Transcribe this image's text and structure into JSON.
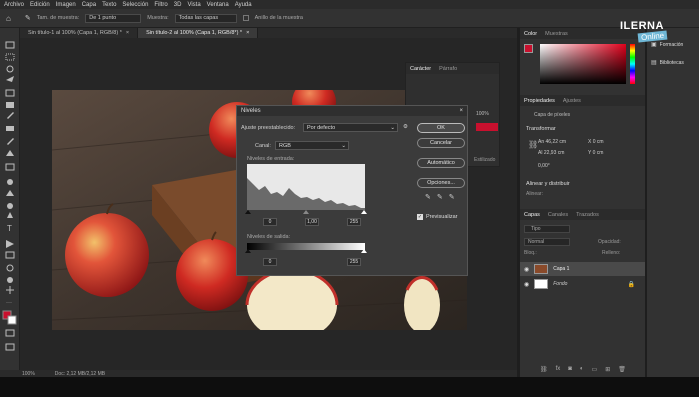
{
  "menubar": [
    "Archivo",
    "Edición",
    "Imagen",
    "Capa",
    "Texto",
    "Selección",
    "Filtro",
    "3D",
    "Vista",
    "Ventana",
    "Ayuda"
  ],
  "options": {
    "sample_size_label": "Tam. de muestra:",
    "sample_size_value": "De 1 punto",
    "sample_label": "Muestra:",
    "sample_value": "Todas las capas",
    "show_ring": "Anillo de la muestra"
  },
  "tabs": [
    {
      "label": "Sin título-1 al 100% (Capa 1, RGB/8) *",
      "active": false
    },
    {
      "label": "Sin título-2 al 100% (Capa 1, RGB/8*) *",
      "active": true
    }
  ],
  "status": {
    "zoom": "100%",
    "doc": "Doc: 2,12 MB/2,12 MB"
  },
  "dialog": {
    "title": "Niveles",
    "preset_label": "Ajuste preestablecido:",
    "preset_value": "Por defecto",
    "channel_label": "Canal:",
    "channel_value": "RGB",
    "input_label": "Niveles de entrada:",
    "input_values": [
      "0",
      "1,00",
      "255"
    ],
    "output_label": "Niveles de salida:",
    "output_values": [
      "0",
      "255"
    ],
    "ok": "OK",
    "cancel": "Cancelar",
    "auto": "Automático",
    "options": "Opciones...",
    "preview": "Previsualizar"
  },
  "char_panel": {
    "tabs": [
      "Carácter",
      "Párrafo"
    ],
    "value": "100%",
    "extra": "Estilizado"
  },
  "color_panel": {
    "tabs": [
      "Color",
      "Muestras"
    ],
    "accent": "#c8102e"
  },
  "properties": {
    "tabs": [
      "Propiedades",
      "Ajustes"
    ],
    "kind": "Capa de píxeles",
    "transform": "Transformar",
    "w": "46,22 cm",
    "h": "22,93 cm",
    "x": "0 cm",
    "y": "0 cm",
    "angle": "0,00°",
    "align": "Alinear y distribuir",
    "align_sub": "Alinear:"
  },
  "layers": {
    "tabs": [
      "Capas",
      "Canales",
      "Trazados"
    ],
    "search": "Tipo",
    "blend": "Normal",
    "opacity_label": "Opacidad:",
    "fill_label": "Relleno:",
    "lock_label": "Bloq.:",
    "items": [
      "Capa 1",
      "Fondo"
    ]
  },
  "far_right": [
    "Formación",
    "Bibliotecas"
  ],
  "logo": {
    "line1": "ILERNA",
    "line2": "Online"
  }
}
